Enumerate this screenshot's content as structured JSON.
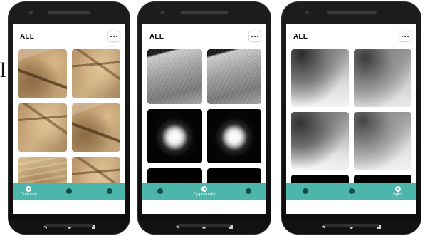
{
  "caption": {
    "glyph": "l"
  },
  "screens": [
    {
      "title": "ALL",
      "thumbs": [
        "mars",
        "mars alt",
        "mars alt",
        "mars",
        "mars dune",
        "mars alt"
      ],
      "tabs": [
        {
          "icon": "rover-icon",
          "label": "Curiosity",
          "active": true
        },
        {
          "icon": "person-icon",
          "label": "",
          "active": false
        },
        {
          "icon": "check-icon",
          "label": "",
          "active": false
        }
      ]
    },
    {
      "title": "ALL",
      "thumbs": [
        "surface",
        "surface",
        "sun",
        "sun",
        "sun sm2",
        "sun sm"
      ],
      "tabs": [
        {
          "icon": "rover-icon",
          "label": "",
          "active": false
        },
        {
          "icon": "person-icon",
          "label": "Opportunity",
          "active": true
        },
        {
          "icon": "check-icon",
          "label": "",
          "active": false
        }
      ]
    },
    {
      "title": "ALL",
      "thumbs": [
        "sky",
        "sky b",
        "sky c",
        "sky d",
        "sun sm2",
        "sun sm"
      ],
      "tabs": [
        {
          "icon": "rover-icon",
          "label": "",
          "active": false
        },
        {
          "icon": "person-icon",
          "label": "",
          "active": false
        },
        {
          "icon": "check-icon",
          "label": "Spirit",
          "active": true
        }
      ]
    }
  ],
  "colors": {
    "tabbar": "#4db6ac",
    "tab_icon": "#0f4f49",
    "navbar": "#121212"
  },
  "icons": {
    "more": "more-dots-icon",
    "back": "back-triangle-icon",
    "home": "home-circle-icon",
    "recent": "recent-square-icon"
  }
}
